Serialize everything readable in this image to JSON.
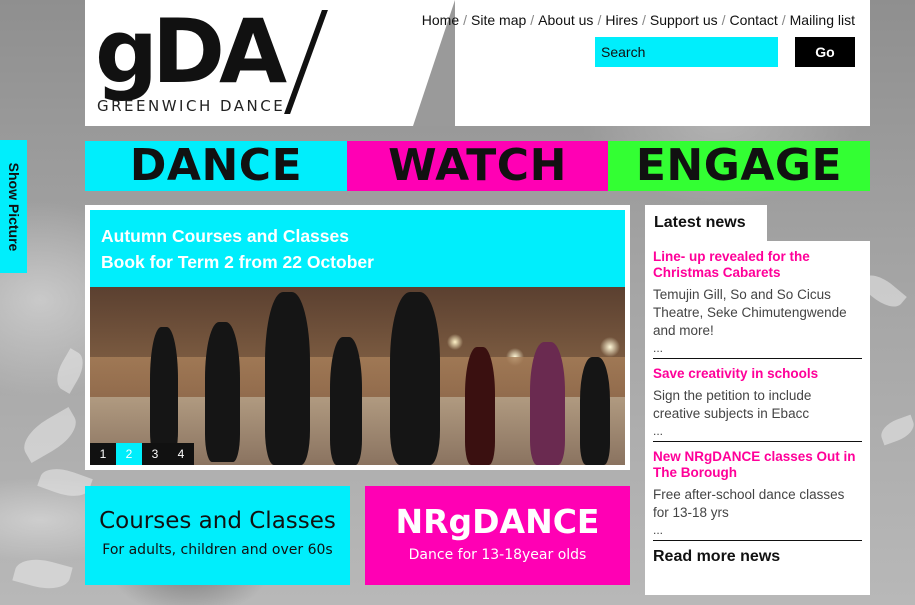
{
  "logo": {
    "mark": "gDA",
    "subtitle": "GREENWICH DANCE"
  },
  "topnav": {
    "items": [
      "Home",
      "Site map",
      "About us",
      "Hires",
      "Support us",
      "Contact",
      "Mailing list"
    ]
  },
  "search": {
    "placeholder": "Search",
    "button_label": "Go"
  },
  "side_tab": {
    "label": "Show Picture"
  },
  "banners": {
    "dance": "DANCE",
    "watch": "WATCH",
    "engage": "ENGAGE"
  },
  "feature": {
    "line1": "Autumn Courses and Classes",
    "line2": "Book for Term 2 from 22 October",
    "slides": [
      "1",
      "2",
      "3",
      "4"
    ],
    "active_slide": "2"
  },
  "boxes": {
    "courses": {
      "title": "Courses and Classes",
      "subtitle": "For adults, children and over 60s"
    },
    "nrg": {
      "title": "NRgDANCE",
      "subtitle": "Dance for 13-18year olds"
    }
  },
  "news": {
    "heading": "Latest news",
    "items": [
      {
        "title": "Line- up revealed for the Christmas Cabarets",
        "body": "Temujin Gill, So and So Cicus Theatre, Seke Chimutengwende and more!",
        "more": "..."
      },
      {
        "title": "Save creativity in schools",
        "body": "Sign the petition to include creative subjects in Ebacc",
        "more": "..."
      },
      {
        "title": "New NRgDANCE classes Out in The Borough",
        "body": "Free after-school dance classes for 13-18 yrs",
        "more": "..."
      }
    ],
    "read_more": "Read more news"
  },
  "colors": {
    "cyan": "#00eefc",
    "magenta": "#ff00b4",
    "green": "#33ff33",
    "news_title": "#ff0099"
  }
}
